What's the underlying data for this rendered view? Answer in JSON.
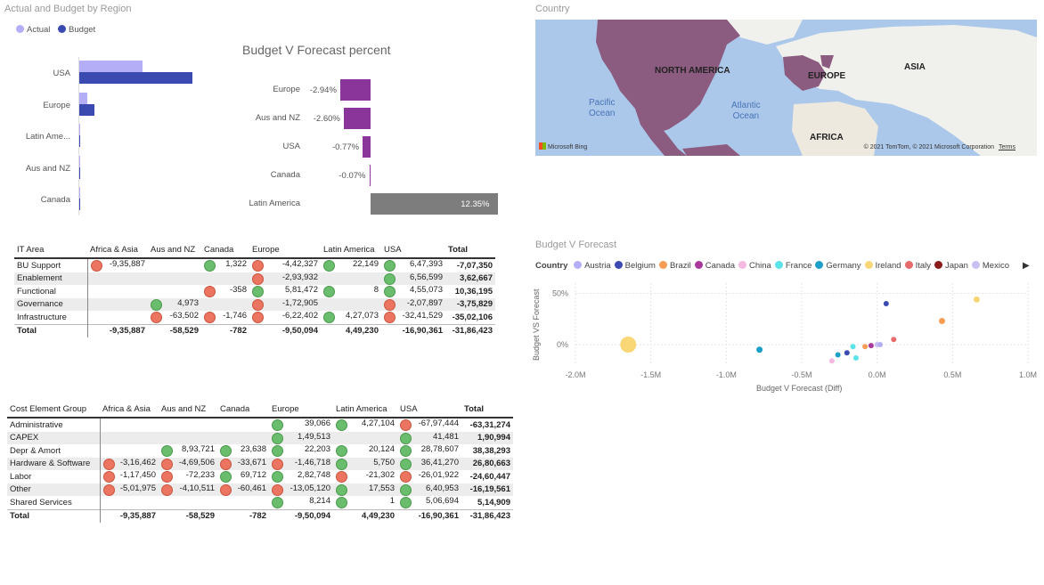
{
  "region_chart": {
    "title": "Actual and Budget by Region",
    "legend": [
      {
        "name": "Actual",
        "color": "#b4aef7"
      },
      {
        "name": "Budget",
        "color": "#3a4ab0"
      }
    ],
    "chart_data": {
      "type": "bar",
      "orientation": "horizontal",
      "categories": [
        "USA",
        "Europe",
        "Latin Ame...",
        "Aus and NZ",
        "Canada"
      ],
      "series": [
        {
          "name": "Actual",
          "values": [
            72,
            10,
            1,
            1,
            1
          ]
        },
        {
          "name": "Budget",
          "values": [
            128,
            18,
            2,
            1,
            1
          ]
        }
      ]
    }
  },
  "bvf_percent": {
    "title": "Budget V Forecast percent",
    "chart_data": {
      "type": "bar",
      "orientation": "horizontal",
      "categories": [
        "Europe",
        "Aus and NZ",
        "USA",
        "Canada",
        "Latin America"
      ],
      "values": [
        -2.94,
        -2.6,
        -0.77,
        -0.07,
        12.35
      ],
      "labels": [
        "-2.94%",
        "-2.60%",
        "-0.77%",
        "-0.07%",
        "12.35%"
      ]
    }
  },
  "map": {
    "title": "Country",
    "labels": {
      "north_america": "NORTH AMERICA",
      "europe": "EUROPE",
      "asia": "ASIA",
      "africa": "AFRICA",
      "pacific": "Pacific\nOcean",
      "atlantic": "Atlantic\nOcean"
    },
    "bing": "Microsoft Bing",
    "copyright": "© 2021 TomTom, © 2021 Microsoft Corporation",
    "terms": "Terms"
  },
  "it_matrix": {
    "headers": [
      "IT Area",
      "Africa & Asia",
      "Aus and NZ",
      "Canada",
      "Europe",
      "Latin America",
      "USA",
      "Total"
    ],
    "rows": [
      {
        "label": "BU Support",
        "cells": [
          [
            "red",
            "-9,35,887"
          ],
          [
            "",
            ""
          ],
          [
            "green",
            "1,322"
          ],
          [
            "red",
            "-4,42,327"
          ],
          [
            "green",
            "22,149"
          ],
          [
            "green",
            "6,47,393"
          ]
        ],
        "total": "-7,07,350"
      },
      {
        "label": "Enablement",
        "cells": [
          [
            "",
            ""
          ],
          [
            "",
            ""
          ],
          [
            "",
            ""
          ],
          [
            "red",
            "-2,93,932"
          ],
          [
            "",
            ""
          ],
          [
            "green",
            "6,56,599"
          ]
        ],
        "total": "3,62,667"
      },
      {
        "label": "Functional",
        "cells": [
          [
            "",
            ""
          ],
          [
            "",
            ""
          ],
          [
            "red",
            "-358"
          ],
          [
            "green",
            "5,81,472"
          ],
          [
            "green",
            "8"
          ],
          [
            "green",
            "4,55,073"
          ]
        ],
        "total": "10,36,195"
      },
      {
        "label": "Governance",
        "cells": [
          [
            "",
            ""
          ],
          [
            "green",
            "4,973"
          ],
          [
            "",
            ""
          ],
          [
            "red",
            "-1,72,905"
          ],
          [
            "",
            ""
          ],
          [
            "red",
            "-2,07,897"
          ]
        ],
        "total": "-3,75,829"
      },
      {
        "label": "Infrastructure",
        "cells": [
          [
            "",
            ""
          ],
          [
            "red",
            "-63,502"
          ],
          [
            "red",
            "-1,746"
          ],
          [
            "red",
            "-6,22,402"
          ],
          [
            "green",
            "4,27,073"
          ],
          [
            "red",
            "-32,41,529"
          ]
        ],
        "total": "-35,02,106"
      }
    ],
    "total": {
      "label": "Total",
      "values": [
        "-9,35,887",
        "-58,529",
        "-782",
        "-9,50,094",
        "4,49,230",
        "-16,90,361"
      ],
      "total": "-31,86,423"
    }
  },
  "cost_matrix": {
    "headers": [
      "Cost Element Group",
      "Africa & Asia",
      "Aus and NZ",
      "Canada",
      "Europe",
      "Latin America",
      "USA",
      "Total"
    ],
    "rows": [
      {
        "label": "Administrative",
        "cells": [
          [
            "",
            ""
          ],
          [
            "",
            ""
          ],
          [
            "",
            ""
          ],
          [
            "green",
            "39,066"
          ],
          [
            "green",
            "4,27,104"
          ],
          [
            "red",
            "-67,97,444"
          ]
        ],
        "total": "-63,31,274"
      },
      {
        "label": "CAPEX",
        "cells": [
          [
            "",
            ""
          ],
          [
            "",
            ""
          ],
          [
            "",
            ""
          ],
          [
            "green",
            "1,49,513"
          ],
          [
            "",
            ""
          ],
          [
            "green",
            "41,481"
          ]
        ],
        "total": "1,90,994"
      },
      {
        "label": "Depr & Amort",
        "cells": [
          [
            "",
            ""
          ],
          [
            "green",
            "8,93,721"
          ],
          [
            "green",
            "23,638"
          ],
          [
            "green",
            "22,203"
          ],
          [
            "green",
            "20,124"
          ],
          [
            "green",
            "28,78,607"
          ]
        ],
        "total": "38,38,293"
      },
      {
        "label": "Hardware & Software",
        "cells": [
          [
            "red",
            "-3,16,462"
          ],
          [
            "red",
            "-4,69,506"
          ],
          [
            "red",
            "-33,671"
          ],
          [
            "red",
            "-1,46,718"
          ],
          [
            "green",
            "5,750"
          ],
          [
            "green",
            "36,41,270"
          ]
        ],
        "total": "26,80,663"
      },
      {
        "label": "Labor",
        "cells": [
          [
            "red",
            "-1,17,450"
          ],
          [
            "red",
            "-72,233"
          ],
          [
            "green",
            "69,712"
          ],
          [
            "green",
            "2,82,748"
          ],
          [
            "red",
            "-21,302"
          ],
          [
            "red",
            "-26,01,922"
          ]
        ],
        "total": "-24,60,447"
      },
      {
        "label": "Other",
        "cells": [
          [
            "red",
            "-5,01,975"
          ],
          [
            "red",
            "-4,10,511"
          ],
          [
            "red",
            "-60,461"
          ],
          [
            "red",
            "-13,05,120"
          ],
          [
            "green",
            "17,553"
          ],
          [
            "green",
            "6,40,953"
          ]
        ],
        "total": "-16,19,561"
      },
      {
        "label": "Shared Services",
        "cells": [
          [
            "",
            ""
          ],
          [
            "",
            ""
          ],
          [
            "",
            ""
          ],
          [
            "green",
            "8,214"
          ],
          [
            "green",
            "1"
          ],
          [
            "green",
            "5,06,694"
          ]
        ],
        "total": "5,14,909"
      }
    ],
    "total": {
      "label": "Total",
      "values": [
        "-9,35,887",
        "-58,529",
        "-782",
        "-9,50,094",
        "4,49,230",
        "-16,90,361"
      ],
      "total": "-31,86,423"
    }
  },
  "scatter": {
    "title": "Budget V Forecast",
    "legend_title": "Country",
    "legend": [
      {
        "name": "Austria",
        "color": "#b4aef7"
      },
      {
        "name": "Belgium",
        "color": "#3a4ab0"
      },
      {
        "name": "Brazil",
        "color": "#f79d55"
      },
      {
        "name": "Canada",
        "color": "#a8389a"
      },
      {
        "name": "China",
        "color": "#f5b8e0"
      },
      {
        "name": "France",
        "color": "#5ce3e8"
      },
      {
        "name": "Germany",
        "color": "#1c9fc9"
      },
      {
        "name": "Ireland",
        "color": "#f9d776"
      },
      {
        "name": "Italy",
        "color": "#e86b6b"
      },
      {
        "name": "Japan",
        "color": "#8b1c1c"
      },
      {
        "name": "Mexico",
        "color": "#c8c0f2"
      }
    ],
    "chart_data": {
      "type": "scatter",
      "xlabel": "Budget V Forecast (Diff)",
      "ylabel": "Budget VS Forecast",
      "x_ticks": [
        "-2.0M",
        "-1.5M",
        "-1.0M",
        "-0.5M",
        "0.0M",
        "0.5M",
        "1.0M"
      ],
      "y_ticks": [
        "50%",
        "0%"
      ],
      "xlim": [
        -2.0,
        1.0
      ],
      "ylim": [
        -20,
        60
      ],
      "points": [
        {
          "x": -1.65,
          "y": 0,
          "color": "#f9d776",
          "size": 9
        },
        {
          "x": -0.78,
          "y": -5,
          "color": "#1c9fc9",
          "size": 3.5
        },
        {
          "x": -0.3,
          "y": -16,
          "color": "#f5b8e0",
          "size": 3
        },
        {
          "x": -0.26,
          "y": -10,
          "color": "#1c9fc9",
          "size": 3
        },
        {
          "x": -0.2,
          "y": -8,
          "color": "#3a4ab0",
          "size": 3
        },
        {
          "x": -0.16,
          "y": -2,
          "color": "#5ce3e8",
          "size": 3
        },
        {
          "x": -0.14,
          "y": -13,
          "color": "#5ce3e8",
          "size": 3
        },
        {
          "x": -0.08,
          "y": -2,
          "color": "#f79d55",
          "size": 3
        },
        {
          "x": -0.04,
          "y": -1,
          "color": "#a8389a",
          "size": 3
        },
        {
          "x": 0.0,
          "y": 0,
          "color": "#c8c0f2",
          "size": 3
        },
        {
          "x": 0.02,
          "y": 0,
          "color": "#b4aef7",
          "size": 3
        },
        {
          "x": 0.06,
          "y": 40,
          "color": "#3a4ab0",
          "size": 3
        },
        {
          "x": 0.11,
          "y": 5,
          "color": "#e86b6b",
          "size": 3
        },
        {
          "x": 0.43,
          "y": 23,
          "color": "#f79d55",
          "size": 3.5
        },
        {
          "x": 0.66,
          "y": 44,
          "color": "#f9d776",
          "size": 3.5
        }
      ]
    }
  }
}
